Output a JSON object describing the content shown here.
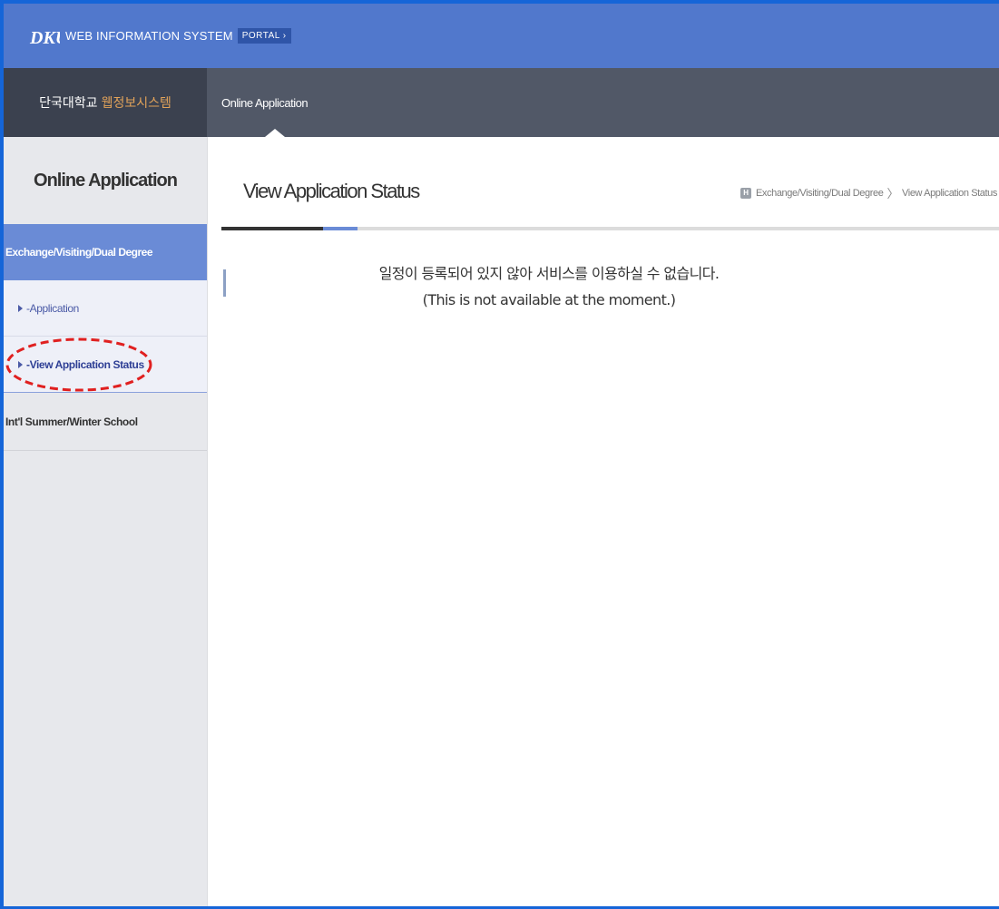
{
  "header": {
    "logo_text": "DKU",
    "system_name": "WEB INFORMATION SYSTEM",
    "portal_badge": "PORTAL ›"
  },
  "nav": {
    "brand_main": "단국대학교",
    "brand_accent": "웹정보시스템",
    "active_tab": "Online Application"
  },
  "sidebar": {
    "title": "Online Application",
    "categories": [
      {
        "label": "Exchange/Visiting/Dual Degree",
        "items": [
          {
            "label": "-Application"
          },
          {
            "label": "-View Application Status"
          }
        ]
      },
      {
        "label": "Int'l Summer/Winter School"
      }
    ]
  },
  "main": {
    "page_title": "View Application Status",
    "breadcrumb": {
      "home_label": "H",
      "items": [
        "Exchange/Visiting/Dual Degree",
        "View Application Status"
      ],
      "separator": "〉"
    },
    "notice_ko": "일정이 등록되어 있지 않아 서비스를 이용하실 수 없습니다.",
    "notice_en": "(This is not available at the moment.)"
  },
  "colors": {
    "topbar": "#5178cc",
    "navbar": "#515867",
    "sidebar_active": "#6a8bd6",
    "brand_accent": "#e2a35a",
    "annotation_circle": "#e02020"
  }
}
